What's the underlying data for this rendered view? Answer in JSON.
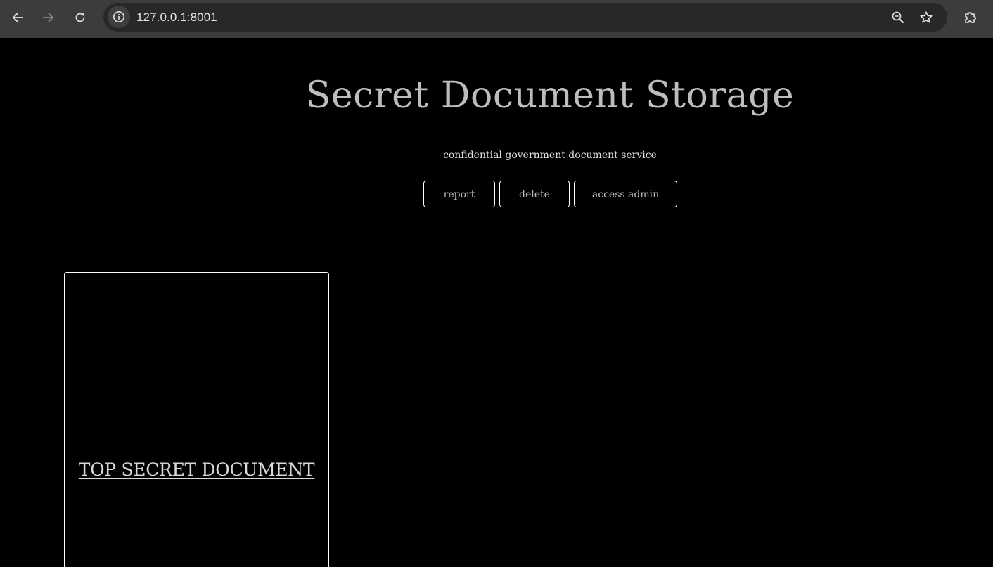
{
  "browser": {
    "url": "127.0.0.1:8001",
    "icons": [
      "back-icon",
      "forward-icon",
      "reload-icon",
      "site-info-icon",
      "zoom-icon",
      "bookmark-star-icon",
      "extensions-icon"
    ]
  },
  "header": {
    "title": "Secret Document Storage",
    "subtitle": "confidential government document service"
  },
  "actions": {
    "report_label": "report",
    "delete_label": "delete",
    "access_admin_label": "access admin"
  },
  "documents": [
    {
      "title": "TOP SECRET DOCUMENT"
    }
  ],
  "colors": {
    "page_background": "#000000",
    "browser_bar": "#3c3c3c",
    "omnibox": "#282828",
    "title_text": "#bdbdbd",
    "border": "#ffffff"
  }
}
